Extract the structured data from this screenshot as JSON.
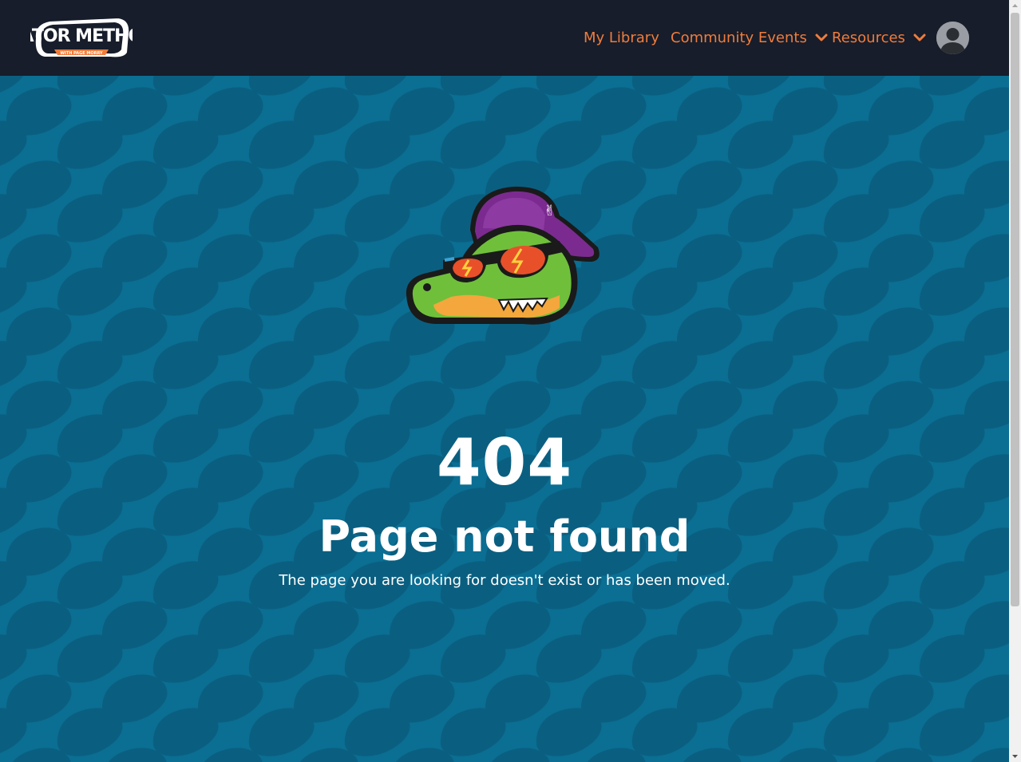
{
  "header": {
    "logo_text": "GATOR METHOD",
    "logo_subtext": "WITH PAGE MORRY",
    "nav": {
      "my_library": "My Library",
      "community_events": "Community Events",
      "resources": "Resources"
    }
  },
  "error": {
    "code": "404",
    "title": "Page not found",
    "message": "The page you are looking for doesn't exist or has been moved."
  },
  "colors": {
    "header_bg": "#171d2a",
    "nav_accent": "#f07c3c",
    "page_bg": "#0b6e93",
    "pattern": "#09597a"
  },
  "icons": {
    "dropdown": "chevron-down-icon",
    "avatar": "user-avatar-icon",
    "mascot": "gator-mascot"
  }
}
